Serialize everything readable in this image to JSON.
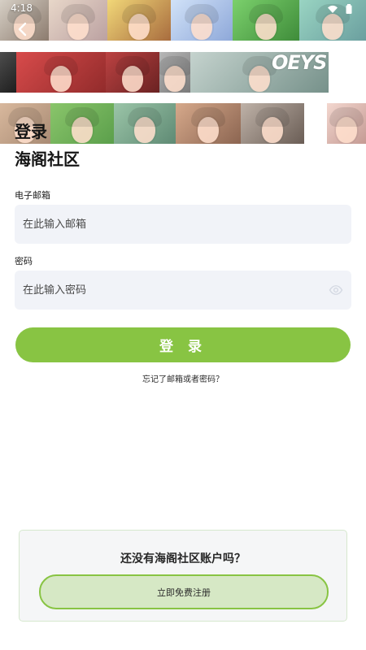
{
  "status_bar": {
    "time": "4:18"
  },
  "banner": {
    "logo_text": "OEYS"
  },
  "header": {
    "title": "登录",
    "app_name": "海阁社区"
  },
  "form": {
    "email_label": "电子邮箱",
    "email_placeholder": "在此输入邮箱",
    "password_label": "密码",
    "password_placeholder": "在此输入密码",
    "login_button_label": "登 录",
    "forgot_link": "忘记了邮箱或者密码？"
  },
  "register": {
    "prompt": "还没有海阁社区账户吗？",
    "button_label": "立即免费注册"
  },
  "colors": {
    "accent": "#88c443",
    "input_background": "#f1f3f8"
  }
}
